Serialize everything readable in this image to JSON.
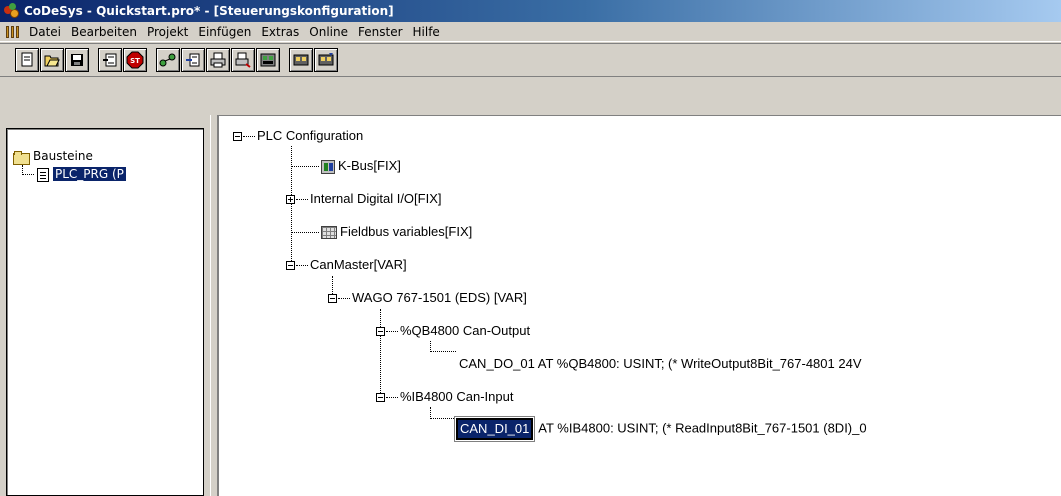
{
  "window": {
    "title": "CoDeSys - Quickstart.pro* - [Steuerungskonfiguration]"
  },
  "menu": {
    "items": [
      "Datei",
      "Bearbeiten",
      "Projekt",
      "Einfügen",
      "Extras",
      "Online",
      "Fenster",
      "Hilfe"
    ]
  },
  "toolbar": {
    "groups": [
      [
        "new-icon",
        "open-icon",
        "save-icon"
      ],
      [
        "login-icon",
        "stop-icon"
      ],
      [
        "logout-icon",
        "download-icon",
        "print-icon",
        "print-preview-icon",
        "find-icon"
      ],
      [
        "find-next-icon",
        "replace-icon"
      ]
    ]
  },
  "left_tree": {
    "root_label": "Bausteine",
    "items": [
      {
        "label": "PLC_PRG (P"
      }
    ]
  },
  "config_tree": {
    "root": "PLC Configuration",
    "kbus": "K-Bus[FIX]",
    "internal_io": "Internal Digital I/O[FIX]",
    "fieldbus": "Fieldbus variables[FIX]",
    "canmaster": "CanMaster[VAR]",
    "wago": "WAGO 767-1501 (EDS)  [VAR]",
    "output": "%QB4800 Can-Output",
    "output_var": "CAN_DO_01 AT %QB4800: USINT; (* WriteOutput8Bit_767-4801 24V",
    "input": "%IB4800 Can-Input",
    "input_edit_value": "CAN_DI_01",
    "input_var_rest": "AT %IB4800: USINT; (* ReadInput8Bit_767-1501 (8DI)_0"
  }
}
